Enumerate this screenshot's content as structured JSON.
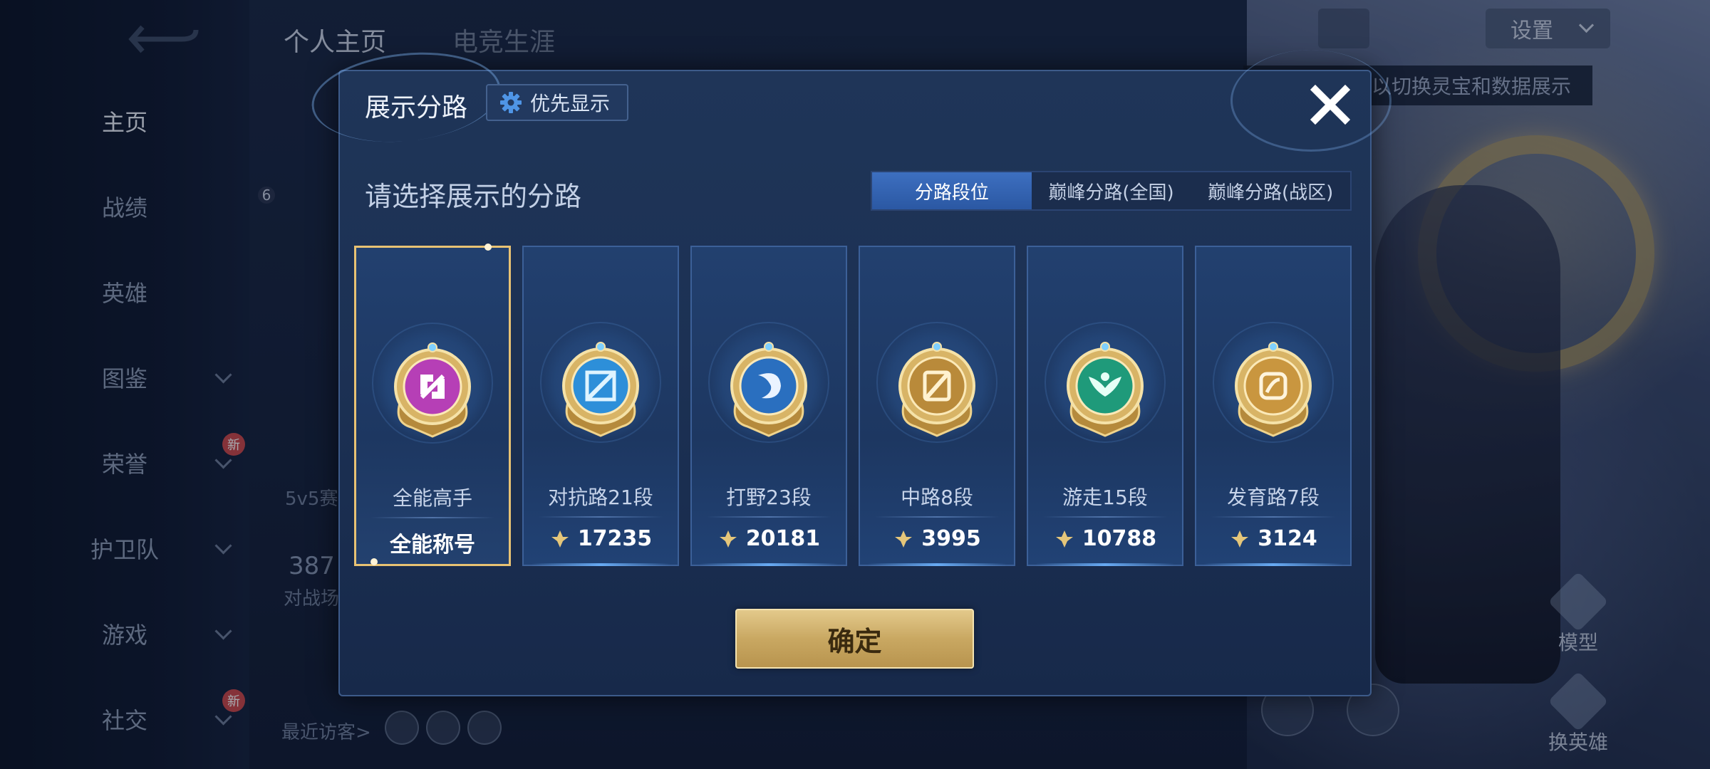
{
  "background": {
    "nav_items": [
      {
        "label": "主页",
        "active": true,
        "chevron": false,
        "new": false
      },
      {
        "label": "战绩",
        "active": false,
        "chevron": false,
        "new": false
      },
      {
        "label": "英雄",
        "active": false,
        "chevron": false,
        "new": false
      },
      {
        "label": "图鉴",
        "active": false,
        "chevron": true,
        "new": false
      },
      {
        "label": "荣誉",
        "active": false,
        "chevron": true,
        "new": true
      },
      {
        "label": "护卫队",
        "active": false,
        "chevron": true,
        "new": false
      },
      {
        "label": "游戏",
        "active": false,
        "chevron": true,
        "new": false
      },
      {
        "label": "社交",
        "active": false,
        "chevron": true,
        "new": true
      }
    ],
    "new_badge": "新",
    "tabs": [
      "个人主页",
      "电竞生涯"
    ],
    "settings_label": "设置",
    "hint_text": "以切换灵宝和数据展示",
    "level_badge": "6",
    "mode_label": "5v5赛",
    "stat_number": "387",
    "stat_label": "对战场",
    "recent_visitors": "最近访客>",
    "model_label": "模型",
    "switch_hero_label": "换英雄"
  },
  "modal": {
    "title": "展示分路",
    "priority_button": "优先显示",
    "subtitle": "请选择展示的分路",
    "tabs": [
      {
        "label": "分路段位",
        "active": true
      },
      {
        "label": "巅峰分路(全国)",
        "active": false
      },
      {
        "label": "巅峰分路(战区)",
        "active": false
      }
    ],
    "cards": [
      {
        "label": "全能高手",
        "value": "全能称号",
        "selected": true,
        "medal_color": "#b63fb6",
        "icon": "allround-icon",
        "show_points": false
      },
      {
        "label": "对抗路21段",
        "value": "17235",
        "selected": false,
        "medal_color": "#2d8fd9",
        "icon": "sword-icon",
        "show_points": true
      },
      {
        "label": "打野23段",
        "value": "20181",
        "selected": false,
        "medal_color": "#2a6fbf",
        "icon": "dragon-icon",
        "show_points": true
      },
      {
        "label": "中路8段",
        "value": "3995",
        "selected": false,
        "medal_color": "#b98a3a",
        "icon": "staff-icon",
        "show_points": true
      },
      {
        "label": "游走15段",
        "value": "10788",
        "selected": false,
        "medal_color": "#1f9a7a",
        "icon": "wings-icon",
        "show_points": true
      },
      {
        "label": "发育路7段",
        "value": "3124",
        "selected": false,
        "medal_color": "#c9963f",
        "icon": "bow-icon",
        "show_points": true
      }
    ],
    "confirm_label": "确定"
  }
}
